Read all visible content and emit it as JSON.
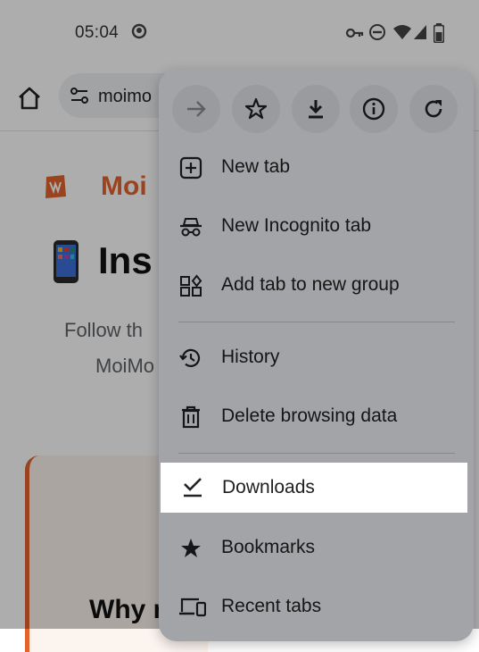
{
  "status_bar": {
    "time": "05:04"
  },
  "toolbar": {
    "url_text": "moimo"
  },
  "page": {
    "brand": "Moi",
    "heading": "Ins",
    "subtitle_line1": "Follow th",
    "subtitle_line2": "MoiMo",
    "section_title": "Why r"
  },
  "menu": {
    "top_buttons": [
      {
        "icon": "forward-arrow-icon"
      },
      {
        "icon": "star-icon"
      },
      {
        "icon": "download-icon"
      },
      {
        "icon": "info-icon"
      },
      {
        "icon": "refresh-icon"
      }
    ],
    "items": [
      {
        "label": "New tab",
        "icon": "new-tab-icon"
      },
      {
        "label": "New Incognito tab",
        "icon": "incognito-icon"
      },
      {
        "label": "Add tab to new group",
        "icon": "tab-group-icon"
      },
      {
        "label": "History",
        "icon": "history-icon"
      },
      {
        "label": "Delete browsing data",
        "icon": "trash-icon"
      },
      {
        "label": "Downloads",
        "icon": "downloads-check-icon"
      },
      {
        "label": "Bookmarks",
        "icon": "bookmark-star-icon"
      },
      {
        "label": "Recent tabs",
        "icon": "devices-icon"
      }
    ]
  },
  "colors": {
    "brand": "#e3632e",
    "menu_bg": "#f1f2f7",
    "highlight": "#ffffff"
  }
}
